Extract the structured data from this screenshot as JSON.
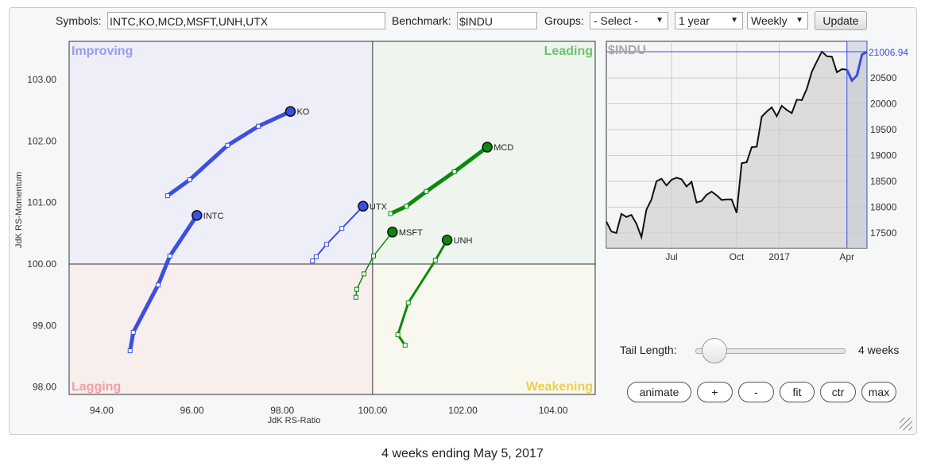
{
  "toolbar": {
    "symbols_label": "Symbols:",
    "symbols_value": "INTC,KO,MCD,MSFT,UNH,UTX",
    "benchmark_label": "Benchmark:",
    "benchmark_value": "$INDU",
    "groups_label": "Groups:",
    "groups_value": "- Select -",
    "period_value": "1 year",
    "interval_value": "Weekly",
    "update_label": "Update"
  },
  "rrg": {
    "quadrants": {
      "improving": "Improving",
      "leading": "Leading",
      "lagging": "Lagging",
      "weakening": "Weakening"
    },
    "xlabel": "JdK RS-Ratio",
    "ylabel": "JdK RS-Momentum",
    "xticks": [
      "94.00",
      "96.00",
      "98.00",
      "100.00",
      "102.00",
      "104.00"
    ],
    "yticks": [
      "98.00",
      "99.00",
      "100.00",
      "101.00",
      "102.00",
      "103.00"
    ],
    "colors": {
      "improving": "#3b4fe0",
      "leading": "#0a8a0a"
    },
    "series": [
      {
        "name": "KO",
        "color": "#3b4fe0",
        "points": [
          [
            95.46,
            101.11
          ],
          [
            95.95,
            101.37
          ],
          [
            96.79,
            101.93
          ],
          [
            97.47,
            102.24
          ],
          [
            98.18,
            102.48
          ]
        ]
      },
      {
        "name": "INTC",
        "color": "#3b4fe0",
        "points": [
          [
            94.63,
            98.59
          ],
          [
            94.7,
            98.89
          ],
          [
            95.25,
            99.66
          ],
          [
            95.51,
            100.13
          ],
          [
            96.11,
            100.79
          ]
        ]
      },
      {
        "name": "UTX",
        "color": "#3b4fe0",
        "points": [
          [
            98.67,
            100.05
          ],
          [
            98.75,
            100.12
          ],
          [
            98.98,
            100.32
          ],
          [
            99.32,
            100.58
          ],
          [
            99.79,
            100.94
          ]
        ]
      },
      {
        "name": "MCD",
        "color": "#0a8a0a",
        "points": [
          [
            100.4,
            100.82
          ],
          [
            100.75,
            100.94
          ],
          [
            101.19,
            101.18
          ],
          [
            101.81,
            101.5
          ],
          [
            102.54,
            101.9
          ]
        ]
      },
      {
        "name": "MSFT",
        "color": "#0a8a0a",
        "points": [
          [
            99.63,
            99.46
          ],
          [
            99.65,
            99.59
          ],
          [
            99.81,
            99.84
          ],
          [
            100.02,
            100.13
          ],
          [
            100.44,
            100.52
          ]
        ]
      },
      {
        "name": "UNH",
        "color": "#0a8a0a",
        "points": [
          [
            100.72,
            98.68
          ],
          [
            100.56,
            98.85
          ],
          [
            100.79,
            99.37
          ],
          [
            101.39,
            100.06
          ],
          [
            101.65,
            100.39
          ]
        ]
      }
    ]
  },
  "benchmark_chart": {
    "title": "$INDU",
    "last_value": "21006.94",
    "yticks": [
      "17500",
      "18000",
      "18500",
      "19000",
      "19500",
      "20000",
      "20500"
    ],
    "xticks": [
      "Jul",
      "Oct",
      "2017",
      "Apr"
    ],
    "values": [
      17720,
      17530,
      17500,
      17870,
      17810,
      17850,
      17680,
      17420,
      17950,
      18150,
      18500,
      18550,
      18420,
      18530,
      18570,
      18540,
      18400,
      18490,
      18090,
      18120,
      18240,
      18300,
      18230,
      18140,
      18150,
      18150,
      17890,
      18850,
      18870,
      19160,
      19170,
      19750,
      19850,
      19930,
      19760,
      19960,
      19880,
      19820,
      20080,
      20070,
      20290,
      20620,
      20820,
      21010,
      20920,
      20910,
      20610,
      20670,
      20660,
      20450,
      20550,
      20950,
      21006.94
    ],
    "tail_start_index": 48
  },
  "controls": {
    "tail_label": "Tail Length:",
    "tail_value": "4 weeks",
    "tail_weeks": 4,
    "buttons": [
      "animate",
      "+",
      "-",
      "fit",
      "ctr",
      "max"
    ]
  },
  "caption": "4 weeks ending May 5, 2017"
}
